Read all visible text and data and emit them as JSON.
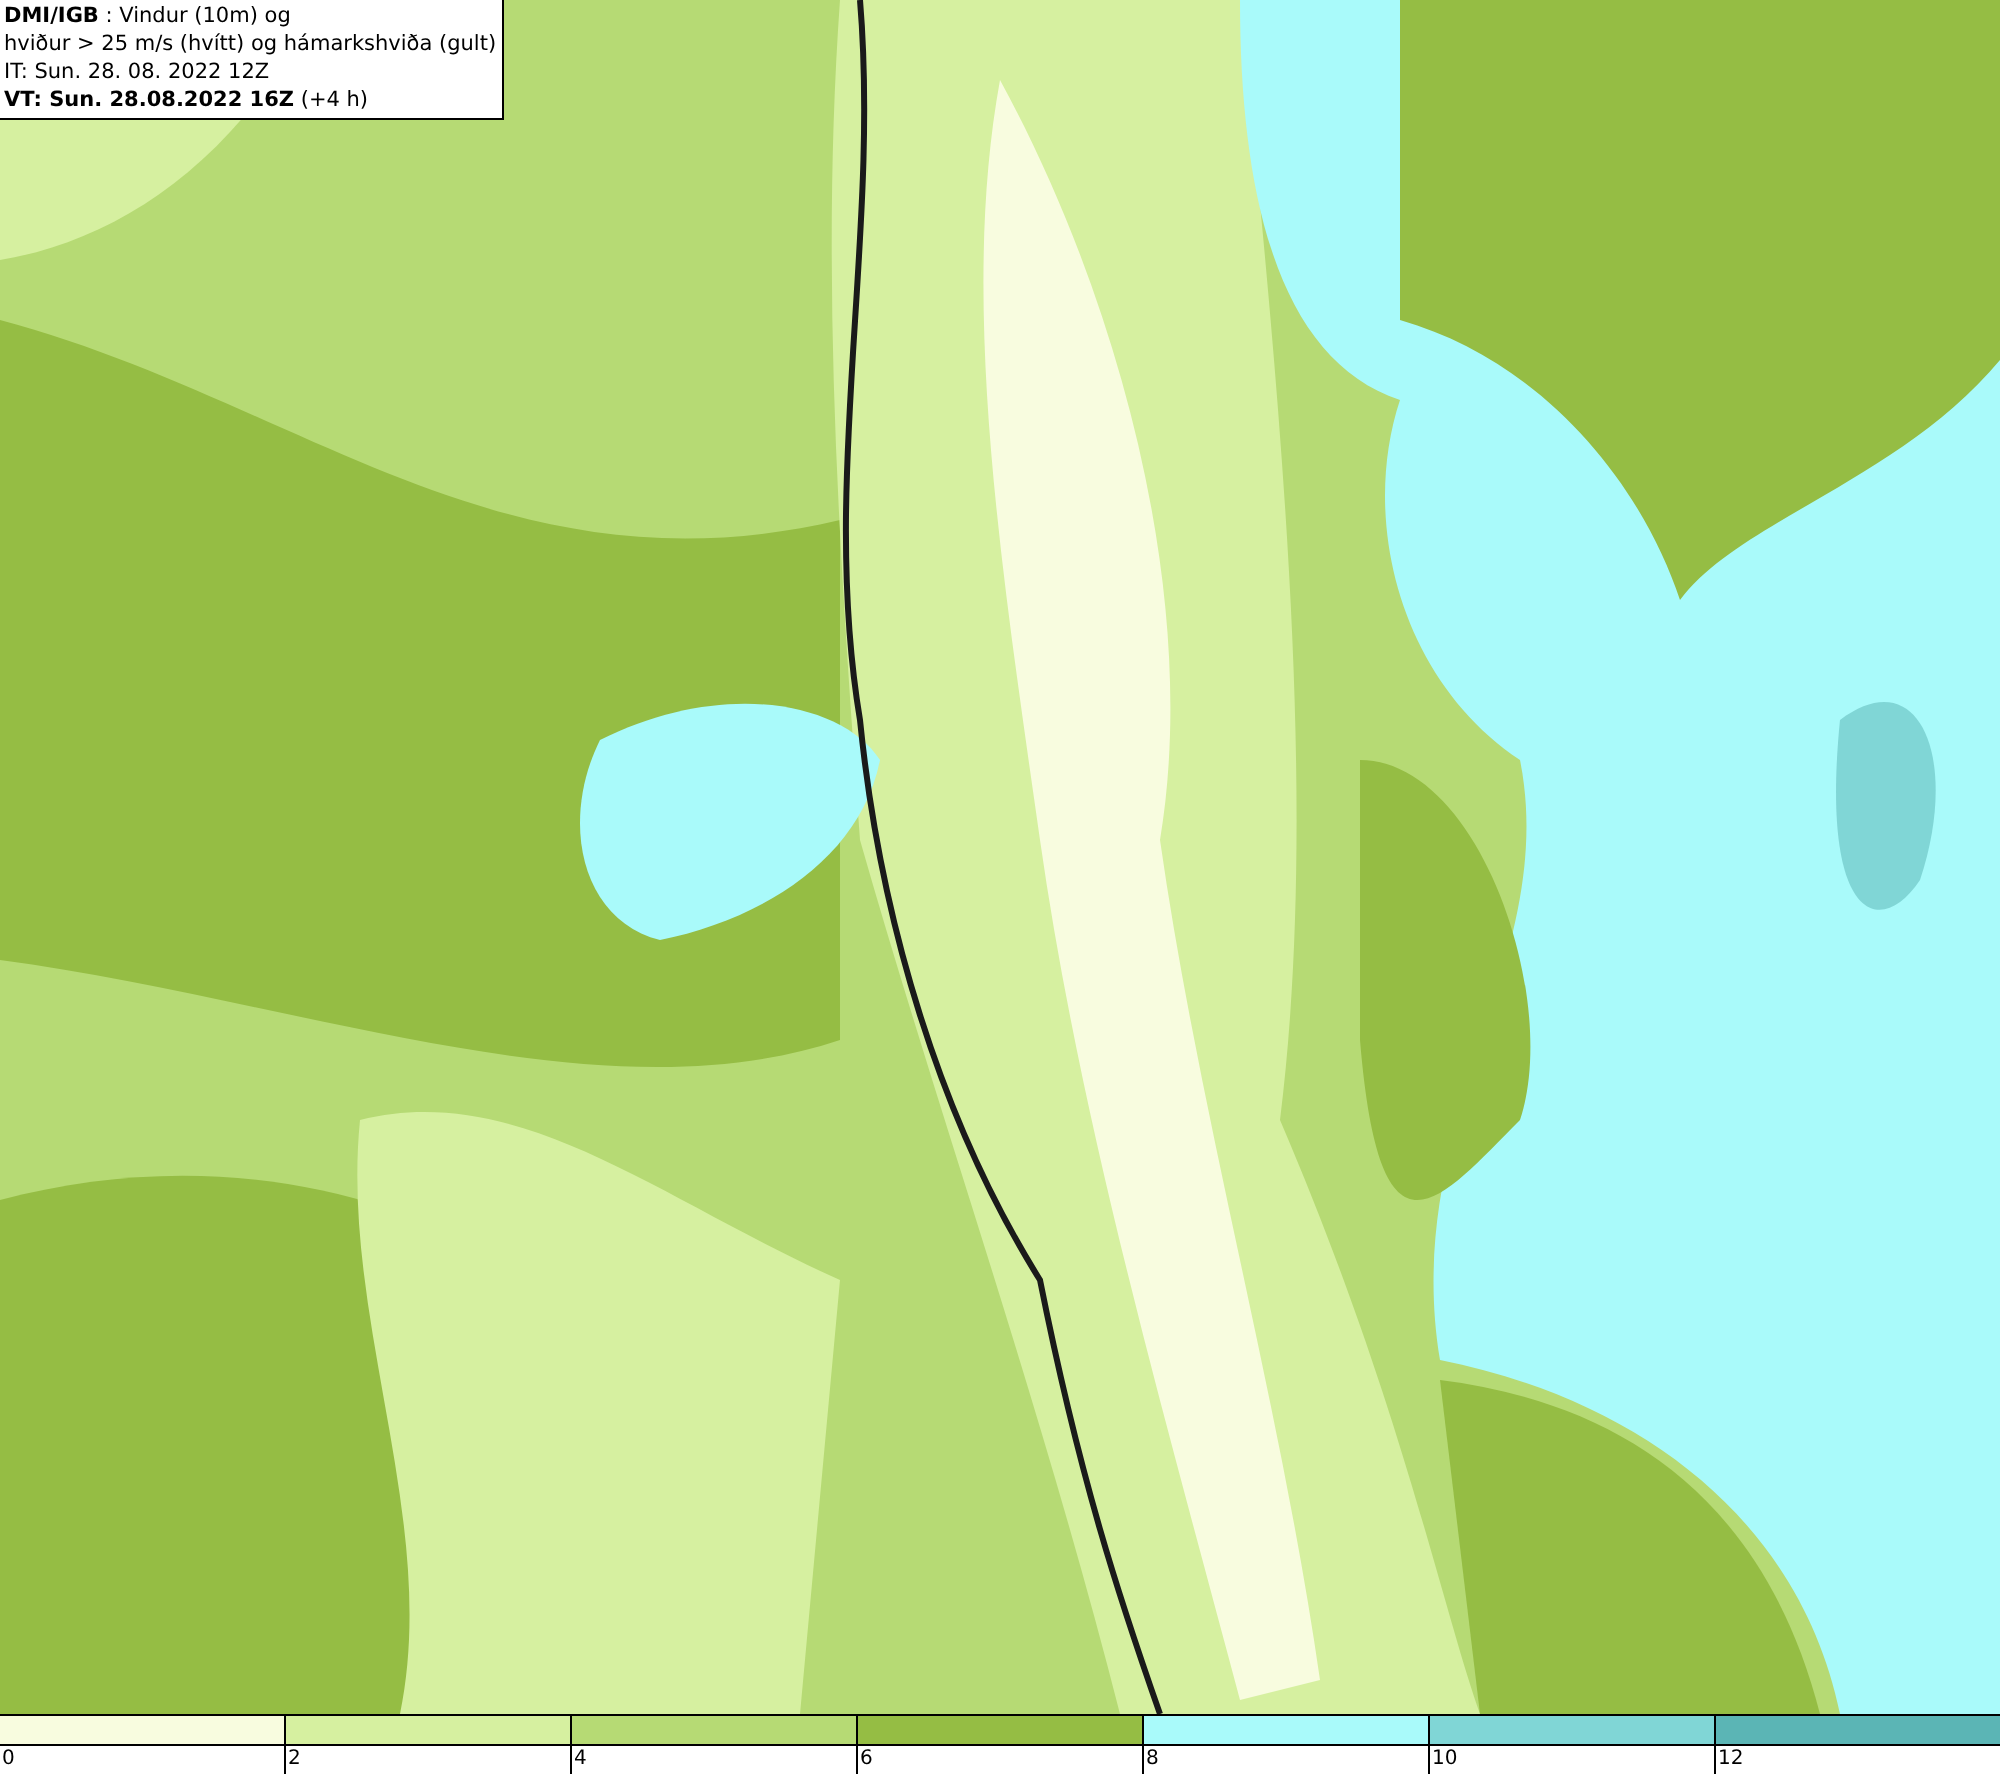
{
  "legend": {
    "lines": [
      "**DMI/IGB** : Vindur (10m) og",
      "hviður > 25 m/s (hvítt) og hámarkshviða (gult)",
      "IT: Sun. 28. 08. 2022 12Z",
      "**VT: Sun. 28.08.2022 16Z** (+4 h)"
    ]
  },
  "colorbar": {
    "segments": [
      {
        "color": "#f8fcdf",
        "tick": "0"
      },
      {
        "color": "#d6f0a0",
        "tick": "2"
      },
      {
        "color": "#b6da74",
        "tick": "4"
      },
      {
        "color": "#95bd44",
        "tick": "6"
      },
      {
        "color": "#a9fafa",
        "tick": "8"
      },
      {
        "color": "#80d6d6",
        "tick": "10"
      },
      {
        "color": "#5bb5b5",
        "tick": "12"
      }
    ]
  }
}
